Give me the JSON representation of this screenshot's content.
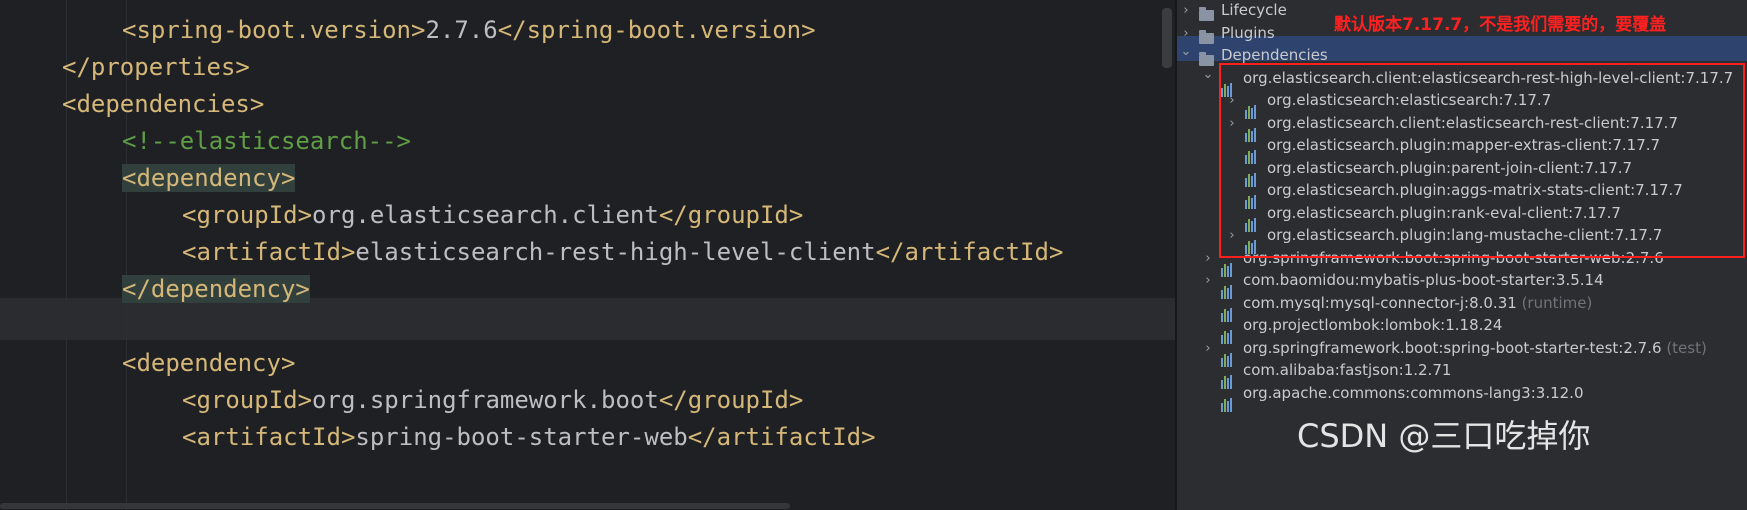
{
  "editor": {
    "lines": [
      {
        "indent": 2,
        "parts": [
          [
            "tag",
            "<spring-boot.version>"
          ],
          [
            "text",
            "2.7.6"
          ],
          [
            "tag",
            "</spring-boot.version>"
          ]
        ]
      },
      {
        "indent": 1,
        "parts": [
          [
            "tag",
            "</properties>"
          ]
        ]
      },
      {
        "indent": 1,
        "parts": [
          [
            "tag",
            "<dependencies>"
          ]
        ]
      },
      {
        "indent": 2,
        "parts": [
          [
            "comment",
            "<!--elasticsearch-->"
          ]
        ]
      },
      {
        "indent": 2,
        "parts": [
          [
            "tag",
            "<dependency>"
          ]
        ],
        "highlight": true
      },
      {
        "indent": 3,
        "parts": [
          [
            "tag",
            "<groupId>"
          ],
          [
            "text",
            "org.elasticsearch.client"
          ],
          [
            "tag",
            "</groupId>"
          ]
        ]
      },
      {
        "indent": 3,
        "parts": [
          [
            "tag",
            "<artifactId>"
          ],
          [
            "text",
            "elasticsearch-rest-high-level-client"
          ],
          [
            "tag",
            "</artifactId>"
          ]
        ]
      },
      {
        "indent": 2,
        "parts": [
          [
            "tag",
            "</dependency>"
          ]
        ],
        "highlight": true,
        "current": true
      },
      {
        "indent": 0,
        "parts": []
      },
      {
        "indent": 2,
        "parts": [
          [
            "tag",
            "<dependency>"
          ]
        ]
      },
      {
        "indent": 3,
        "parts": [
          [
            "tag",
            "<groupId>"
          ],
          [
            "text",
            "org.springframework.boot"
          ],
          [
            "tag",
            "</groupId>"
          ]
        ]
      },
      {
        "indent": 3,
        "parts": [
          [
            "tag",
            "<artifactId>"
          ],
          [
            "text",
            "spring-boot-starter-web"
          ],
          [
            "tag",
            "</artifactId>"
          ]
        ]
      }
    ]
  },
  "maven": {
    "annotation": "默认版本7.17.7，不是我们需要的，要覆盖",
    "nodes": [
      {
        "label": "Lifecycle",
        "level": 0,
        "arrow": "›",
        "icon": "folder"
      },
      {
        "label": "Plugins",
        "level": 0,
        "arrow": "›",
        "icon": "folder"
      },
      {
        "label": "Dependencies",
        "level": 0,
        "arrow": "⌄",
        "icon": "folder",
        "selected": true
      },
      {
        "label": "org.elasticsearch.client:elasticsearch-rest-high-level-client:7.17.7",
        "level": 1,
        "arrow": "⌄",
        "icon": "lib"
      },
      {
        "label": "org.elasticsearch:elasticsearch:7.17.7",
        "level": 2,
        "arrow": "›",
        "icon": "lib"
      },
      {
        "label": "org.elasticsearch.client:elasticsearch-rest-client:7.17.7",
        "level": 2,
        "arrow": "›",
        "icon": "lib"
      },
      {
        "label": "org.elasticsearch.plugin:mapper-extras-client:7.17.7",
        "level": 2,
        "arrow": "",
        "icon": "lib"
      },
      {
        "label": "org.elasticsearch.plugin:parent-join-client:7.17.7",
        "level": 2,
        "arrow": "",
        "icon": "lib"
      },
      {
        "label": "org.elasticsearch.plugin:aggs-matrix-stats-client:7.17.7",
        "level": 2,
        "arrow": "",
        "icon": "lib"
      },
      {
        "label": "org.elasticsearch.plugin:rank-eval-client:7.17.7",
        "level": 2,
        "arrow": "",
        "icon": "lib"
      },
      {
        "label": "org.elasticsearch.plugin:lang-mustache-client:7.17.7",
        "level": 2,
        "arrow": "›",
        "icon": "lib"
      },
      {
        "label": "org.springframework.boot:spring-boot-starter-web:2.7.6",
        "level": 1,
        "arrow": "›",
        "icon": "lib"
      },
      {
        "label": "com.baomidou:mybatis-plus-boot-starter:3.5.14",
        "level": 1,
        "arrow": "›",
        "icon": "lib"
      },
      {
        "label": "com.mysql:mysql-connector-j:8.0.31",
        "suffix": "(runtime)",
        "level": 1,
        "arrow": "",
        "icon": "lib"
      },
      {
        "label": "org.projectlombok:lombok:1.18.24",
        "level": 1,
        "arrow": "",
        "icon": "lib"
      },
      {
        "label": "org.springframework.boot:spring-boot-starter-test:2.7.6",
        "suffix": "(test)",
        "level": 1,
        "arrow": "›",
        "icon": "lib"
      },
      {
        "label": "com.alibaba:fastjson:1.2.71",
        "level": 1,
        "arrow": "",
        "icon": "lib"
      },
      {
        "label": "org.apache.commons:commons-lang3:3.12.0",
        "level": 1,
        "arrow": "",
        "icon": "lib"
      }
    ]
  },
  "watermark": "CSDN @三口吃掉你",
  "colors": {
    "tag": "#d5b778",
    "text": "#bcbec4",
    "comment": "#5f9e45",
    "selection": "#2e436e",
    "redbox": "#ff1f1f"
  }
}
